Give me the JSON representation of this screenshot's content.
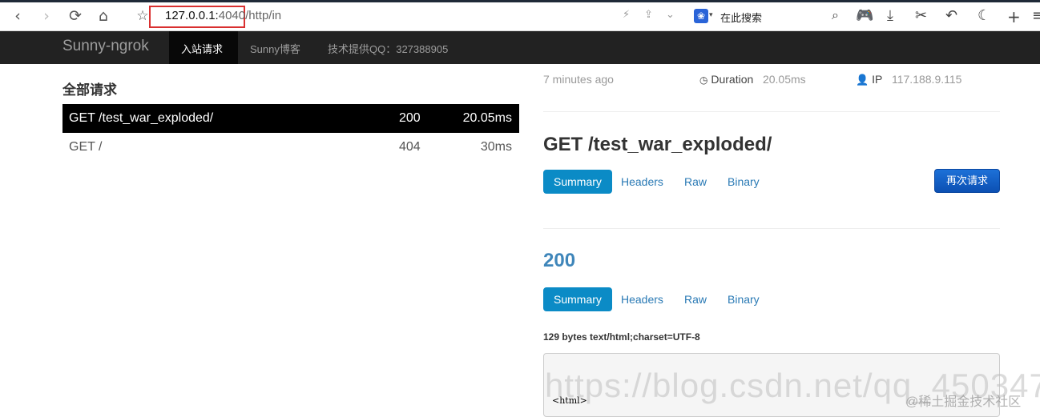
{
  "browser": {
    "url_host": "127.0.0.1:",
    "url_port": "4040",
    "url_path": "/http/in",
    "search_placeholder": "在此搜索",
    "icons": [
      "back-icon",
      "forward-icon",
      "reload-icon",
      "home-icon",
      "star-icon",
      "lightning-icon",
      "share-icon",
      "chevron-down-icon",
      "baidu-icon",
      "search-icon",
      "gamepad-icon",
      "download-icon",
      "scissors-icon",
      "undo-icon",
      "moon-icon",
      "plus-icon",
      "menu-icon"
    ]
  },
  "navbar": {
    "brand": "Sunny-ngrok",
    "links": [
      "入站请求",
      "Sunny博客",
      "技术提供QQ：327388905"
    ]
  },
  "left": {
    "title": "全部请求",
    "requests": [
      {
        "path": "GET /test_war_exploded/",
        "status": "200",
        "duration": "20.05ms",
        "selected": true
      },
      {
        "path": "GET /",
        "status": "404",
        "duration": "30ms",
        "selected": false
      }
    ]
  },
  "detail": {
    "time_ago": "7 minutes ago",
    "duration_label": "Duration",
    "duration_value": "20.05ms",
    "ip_label": "IP",
    "ip_value": "117.188.9.115",
    "request_title": "GET /test_war_exploded/",
    "request_tabs": [
      "Summary",
      "Headers",
      "Raw",
      "Binary"
    ],
    "replay_label": "再次请求",
    "status_code": "200",
    "response_tabs": [
      "Summary",
      "Headers",
      "Raw",
      "Binary"
    ],
    "response_meta": "129 bytes text/html;charset=UTF-8",
    "body_first_line": "<html>"
  },
  "watermarks": {
    "csdn": "https://blog.csdn.net/qq_450347",
    "juejin": "@稀土掘金技术社区"
  },
  "colors": {
    "navbar_bg": "#222222",
    "pill_active": "#0b8bc6",
    "link": "#2a7ab5",
    "replay_button": "#1d71d8",
    "status_code": "#3f86ba",
    "url_highlight": "#d93030"
  }
}
